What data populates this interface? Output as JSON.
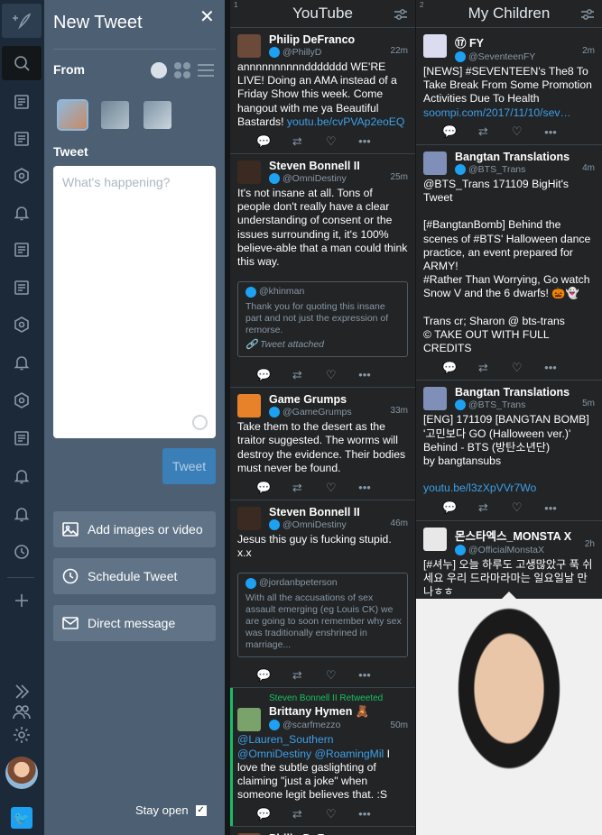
{
  "nav": {
    "icons": [
      "compose-icon",
      "search-icon",
      "column-home-icon",
      "column-home-icon",
      "column-user-icon",
      "notifications-icon",
      "column-home-icon",
      "column-home-icon",
      "column-user-icon",
      "notifications-icon",
      "column-user-icon",
      "column-home-icon",
      "notifications-icon",
      "notifications-icon",
      "scheduled-icon",
      "add-column-icon",
      "expand-icon",
      "accounts-icon",
      "settings-icon"
    ]
  },
  "compose": {
    "title": "New Tweet",
    "close": "✕",
    "from_label": "From",
    "tweet_label": "Tweet",
    "placeholder": "What's happening?",
    "tweet_button": "Tweet",
    "add_media": "Add images or video",
    "schedule": "Schedule Tweet",
    "dm": "Direct message",
    "stay_open": "Stay open",
    "stay_open_check": "✓"
  },
  "columns": [
    {
      "num": "1",
      "title": "YouTube",
      "tweets": [
        {
          "name": "Philip DeFranco",
          "handle": "@PhillyD",
          "time": "22m",
          "body": "annnnnnnnnnddddddd WE'RE LIVE! Doing an AMA instead of a Friday Show this week. Come hangout with me ya Beautiful Bastards! ",
          "link": "youtu.be/cvPVAp2eoEQ",
          "pic": "#6b4a3a"
        },
        {
          "name": "Steven Bonnell II",
          "handle": "@OmniDestiny",
          "time": "25m",
          "body": "It's not insane at all. Tons of people don't really have a clear understanding of consent or the issues surrounding it, it's 100% believe-able that a man could think this way.",
          "pic": "#3b2a22",
          "quote": {
            "handle": "@khinman",
            "text": "Thank you for quoting this insane part and not just the expression of remorse.",
            "attach": "Tweet attached"
          }
        },
        {
          "name": "Game Grumps",
          "handle": "@GameGrumps",
          "time": "33m",
          "body": "Take them to the desert as the traitor suggested. The worms will destroy the evidence. Their bodies must never be found.",
          "pic": "#e8822a"
        },
        {
          "name": "Steven Bonnell II",
          "handle": "@OmniDestiny",
          "time": "46m",
          "body": "Jesus this guy is fucking stupid. x.x",
          "pic": "#3b2a22",
          "quote": {
            "handle": "@jordanbpeterson",
            "text": "With all the accusations of sex assault emerging (eg Louis CK) we are going to soon remember why sex was traditionally enshrined in marriage..."
          }
        },
        {
          "retweeted": "Steven Bonnell II Retweeted",
          "name": "Brittany Hymen 🧸",
          "handle": "@scarfmezzo",
          "time": "50m",
          "bodylink": "@Lauren_Southern @OmniDestiny @RoamingMil",
          "body": " I love the subtle gaslighting of claiming \"just a joke\" when someone legit believes that. :S",
          "pic": "#7aa36b"
        },
        {
          "name": "Philip DeFranco",
          "handle": "",
          "time": "",
          "body": "",
          "pic": "#6b4a3a"
        }
      ]
    },
    {
      "num": "2",
      "title": "My Children",
      "tweets": [
        {
          "name": "⑰ FY",
          "handle": "@SeventeenFY",
          "time": "2m",
          "body": "[NEWS] #SEVENTEEN's The8 To Take Break From Some Promotion Activities Due To Health ",
          "link": "soompi.com/2017/11/10/sev…",
          "pic": "#dcdcf0"
        },
        {
          "name": "Bangtan Translations",
          "handle": "@BTS_Trans",
          "time": "4m",
          "body": "@BTS_Trans 171109 BigHit's Tweet\n\n[#BangtanBomb] Behind the scenes of #BTS' Halloween dance practice, an event prepared for ARMY!\n#Rather Than Worrying, Go watch Snow V and the 6 dwarfs! 🎃👻\n\nTrans cr; Sharon @ bts-trans\n© TAKE OUT WITH FULL CREDITS",
          "pic": "#7f8fb8"
        },
        {
          "name": "Bangtan Translations",
          "handle": "@BTS_Trans",
          "time": "5m",
          "body": "[ENG] 171109 [BANGTAN BOMB] '고민보다 GO (Halloween ver.)' Behind - BTS (방탄소년단)\nby bangtansubs\n\n",
          "link": "youtu.be/l3zXpVVr7Wo",
          "pic": "#7f8fb8"
        },
        {
          "name": "몬스타엑스_MONSTA X",
          "handle": "@OfficialMonstaX",
          "time": "2h",
          "body": "[#셔누] 오늘 하루도 고생많았구 푹 쉬세요 우리 드라마라마는 일요일날 만나ㅎㅎ",
          "pic": "#e8e8e8"
        }
      ]
    }
  ]
}
